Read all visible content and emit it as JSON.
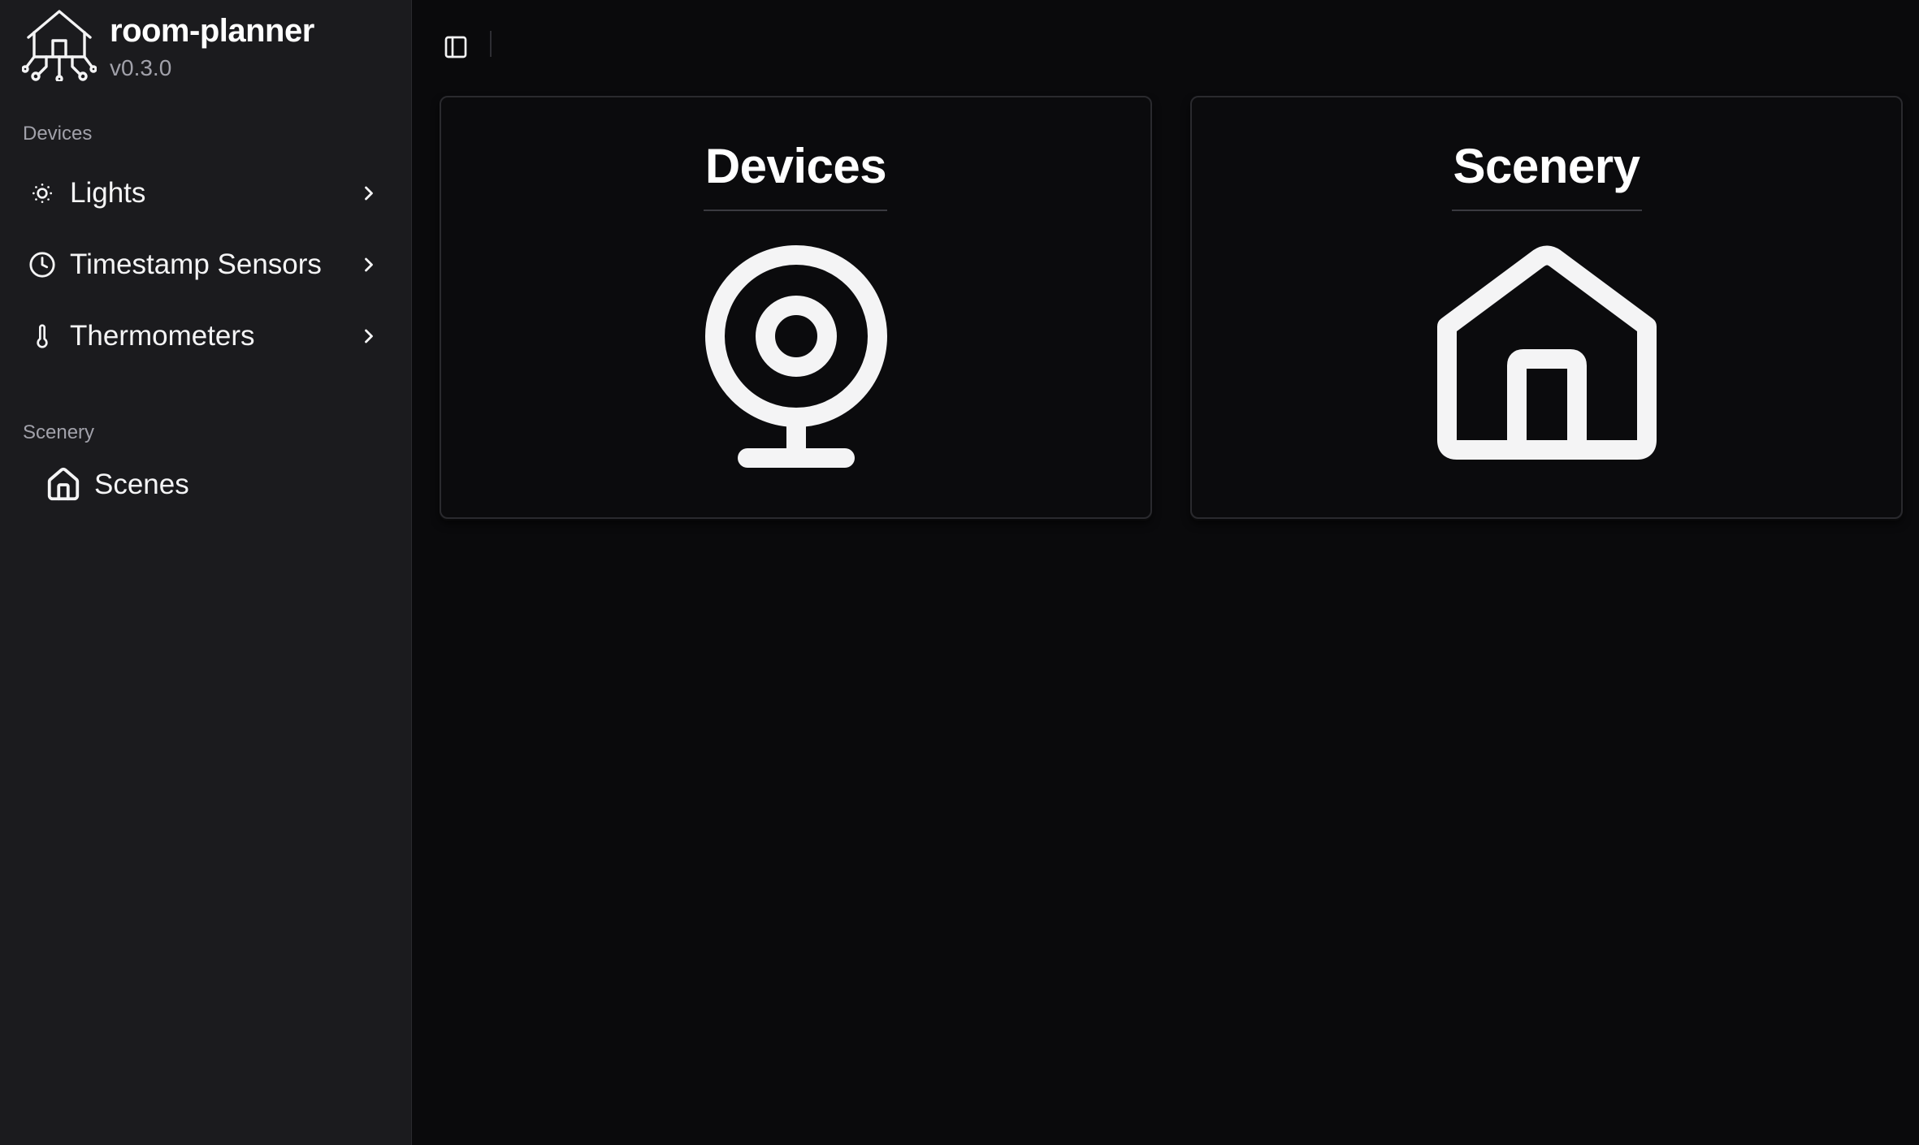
{
  "app": {
    "name": "room-planner",
    "version": "v0.3.0"
  },
  "sidebar": {
    "groups": [
      {
        "label": "Devices",
        "items": [
          {
            "label": "Lights",
            "icon": "sun-dim-icon",
            "has_chevron": true
          },
          {
            "label": "Timestamp Sensors",
            "icon": "clock-icon",
            "has_chevron": true
          },
          {
            "label": "Thermometers",
            "icon": "thermometer-icon",
            "has_chevron": true
          }
        ]
      },
      {
        "label": "Scenery",
        "items": [
          {
            "label": "Scenes",
            "icon": "house-icon",
            "has_chevron": false
          }
        ]
      }
    ]
  },
  "toolbar": {
    "toggle_icon": "panel-left-icon"
  },
  "cards": [
    {
      "title": "Devices",
      "icon": "webcam-icon"
    },
    {
      "title": "Scenery",
      "icon": "house-icon"
    }
  ],
  "colors": {
    "background": "#0a0a0c",
    "sidebar": "#1b1b1e",
    "text": "#f7f7f8",
    "muted": "#a1a1aa"
  }
}
